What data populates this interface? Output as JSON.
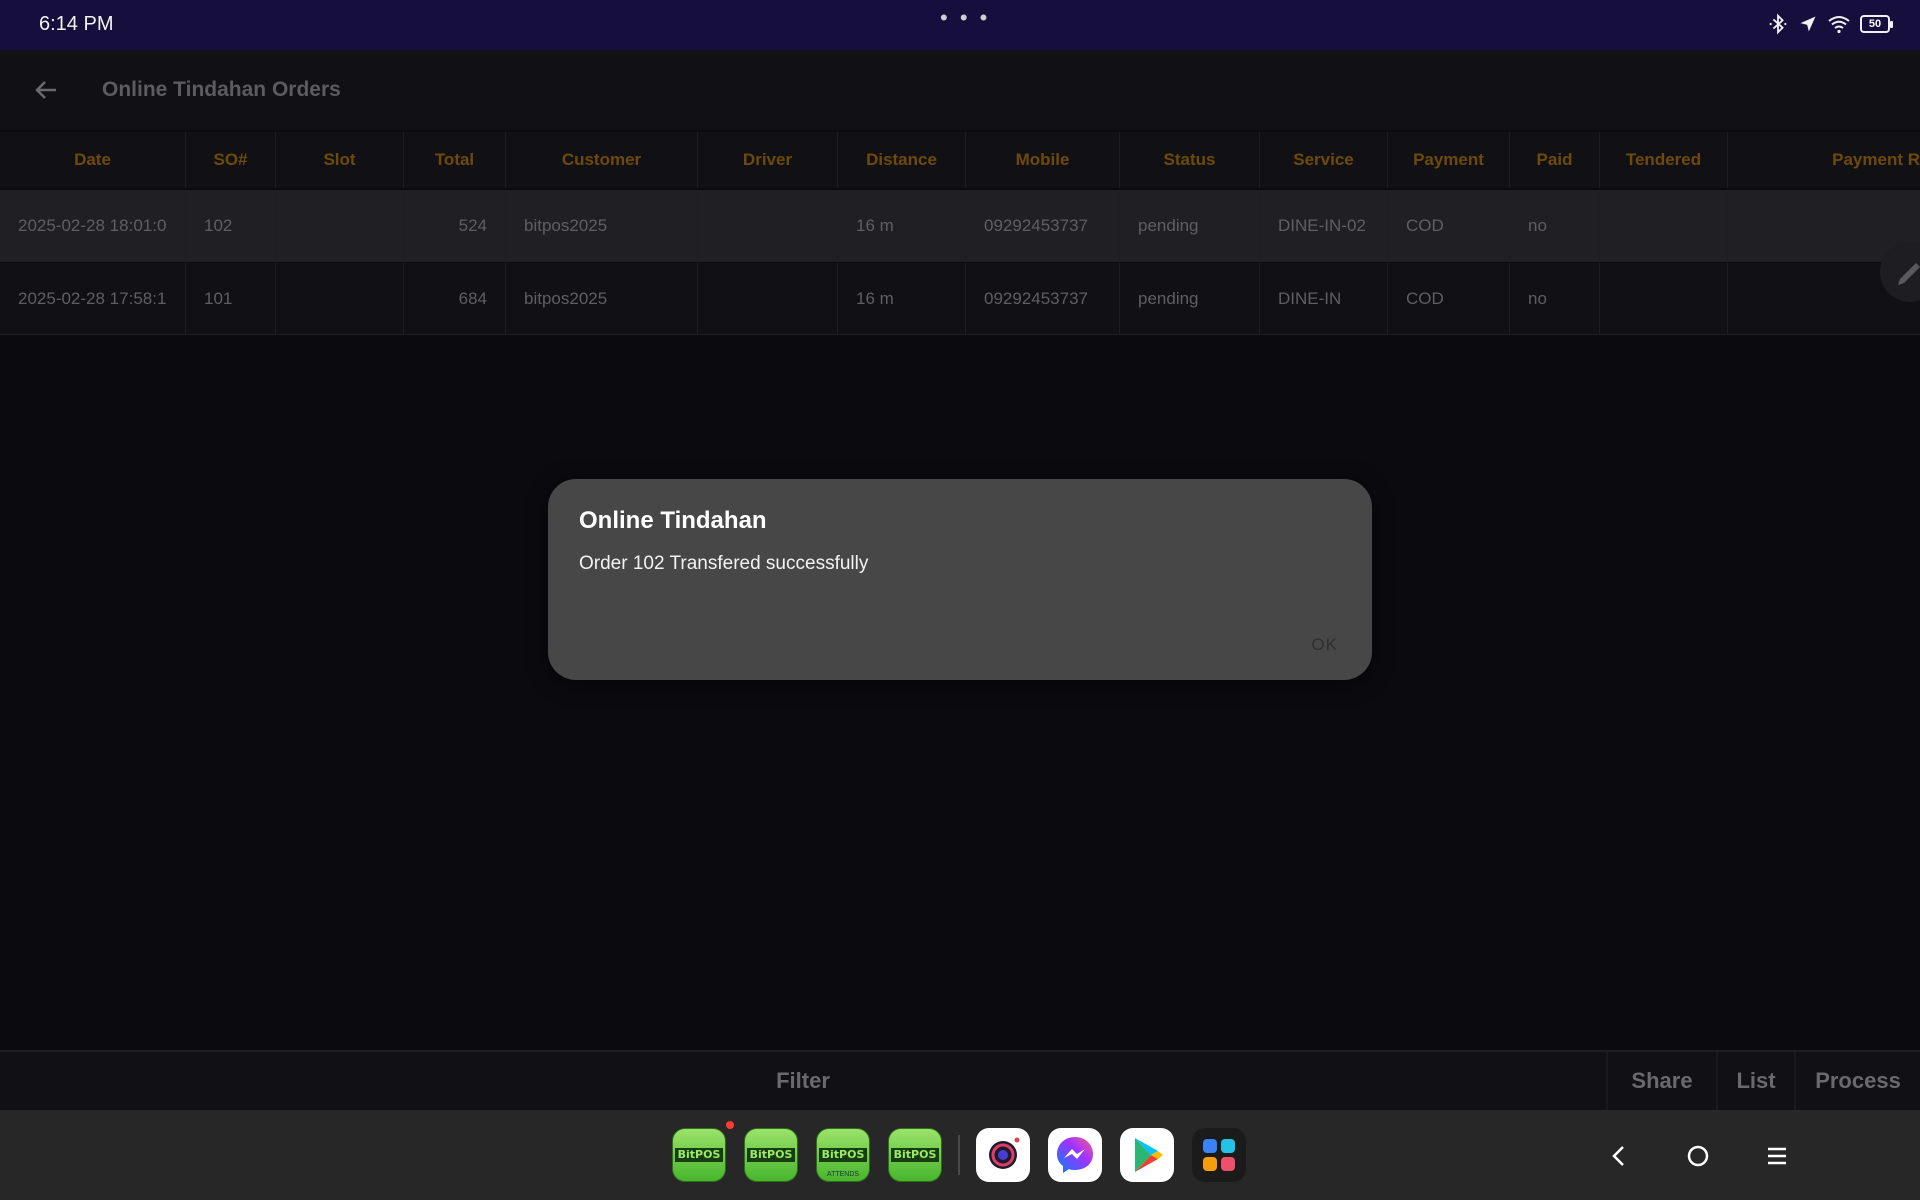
{
  "status_bar": {
    "time": "6:14 PM",
    "more_indicator": "• • •",
    "battery": "50",
    "icons": [
      "bluetooth-icon",
      "location-icon",
      "wifi-icon",
      "battery-icon"
    ]
  },
  "app": {
    "title": "Online Tindahan Orders"
  },
  "table": {
    "columns": [
      "Date",
      "SO#",
      "Slot",
      "Total",
      "Customer",
      "Driver",
      "Distance",
      "Mobile",
      "Status",
      "Service",
      "Payment",
      "Paid",
      "Tendered",
      "Payment R"
    ],
    "rows": [
      {
        "date": "2025-02-28 18:01:0",
        "so": "102",
        "slot": "",
        "total": "524",
        "customer": "bitpos2025",
        "driver": "",
        "distance": "16 m",
        "mobile": "09292453737",
        "status": "pending",
        "service": "DINE-IN-02",
        "payment": "COD",
        "paid": "no",
        "tendered": "",
        "payment_ref": ""
      },
      {
        "date": "2025-02-28 17:58:1",
        "so": "101",
        "slot": "",
        "total": "684",
        "customer": "bitpos2025",
        "driver": "",
        "distance": "16 m",
        "mobile": "09292453737",
        "status": "pending",
        "service": "DINE-IN",
        "payment": "COD",
        "paid": "no",
        "tendered": "",
        "payment_ref": ""
      }
    ]
  },
  "dialog": {
    "title": "Online Tindahan",
    "message": "Order 102 Transfered successfully",
    "ok_label": "OK"
  },
  "bottom_bar": {
    "filter_label": "Filter",
    "share_label": "Share",
    "list_label": "List",
    "process_label": "Process"
  },
  "dock": {
    "apps": [
      {
        "label": "BitPOS",
        "sub": ""
      },
      {
        "label": "BitPOS",
        "sub": ""
      },
      {
        "label": "BitPOS",
        "sub": "ATTENDS"
      },
      {
        "label": "BitPOS",
        "sub": ""
      }
    ],
    "other_apps": [
      "camera-app-icon",
      "messenger-app-icon",
      "play-store-icon",
      "app-launcher-icon"
    ]
  },
  "colors": {
    "status_bar_bg": "#160f3d",
    "header_text": "#6e4a0a",
    "dialog_bg": "#474747",
    "background": "#0b0b0f"
  }
}
